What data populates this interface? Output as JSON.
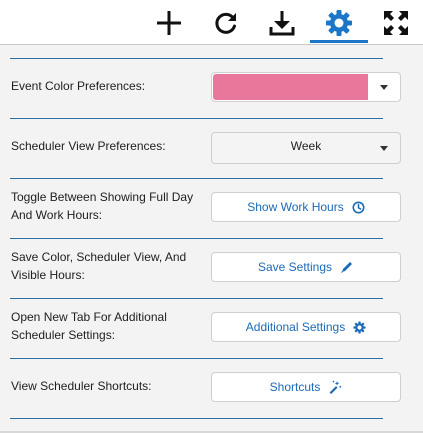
{
  "toolbar": {
    "icons": [
      "add-icon",
      "refresh-icon",
      "download-icon",
      "settings-icon",
      "expand-icon"
    ],
    "active_tab": "settings-icon",
    "accent_color": "#1b76c8"
  },
  "settings": {
    "event_color": {
      "label": "Event Color Preferences:",
      "selected_color": "#e8779b"
    },
    "scheduler_view": {
      "label": "Scheduler View Preferences:",
      "selected": "Week"
    },
    "toggle_hours": {
      "label": "Toggle Between Showing Full Day And Work Hours:",
      "button": "Show Work Hours",
      "icon": "clock-icon"
    },
    "save": {
      "label": "Save Color, Scheduler View, And Visible Hours:",
      "button": "Save Settings",
      "icon": "pencil-icon"
    },
    "additional": {
      "label": "Open New Tab For Additional Scheduler Settings:",
      "button": "Additional Settings",
      "icon": "gear-icon"
    },
    "shortcuts": {
      "label": "View Scheduler Shortcuts:",
      "button": "Shortcuts",
      "icon": "magic-wand-icon"
    }
  }
}
